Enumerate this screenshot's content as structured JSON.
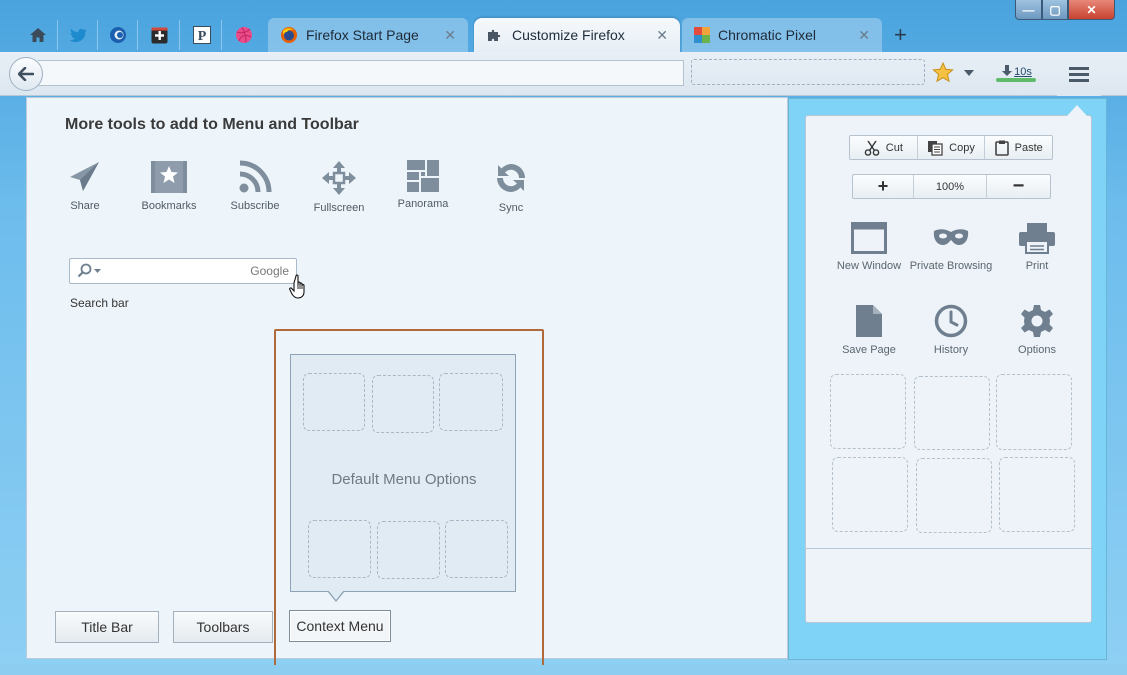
{
  "window": {
    "controls": {
      "minimize": "—",
      "maximize": "▢",
      "close": "✕"
    }
  },
  "tabs": {
    "pinned": [
      {
        "name": "home-icon"
      },
      {
        "name": "twitter-icon"
      },
      {
        "name": "thunderbird-icon"
      },
      {
        "name": "google-plus-icon"
      },
      {
        "name": "pinterest-icon"
      },
      {
        "name": "dribbble-icon"
      }
    ],
    "items": [
      {
        "label": "Firefox Start Page",
        "icon": "firefox-icon",
        "active": false
      },
      {
        "label": "Customize Firefox",
        "icon": "puzzle-icon",
        "active": true
      },
      {
        "label": "Chromatic Pixel",
        "icon": "chromatic-pixel-icon",
        "active": false
      }
    ],
    "close_glyph": "✕",
    "new_tab_glyph": "+"
  },
  "navbar": {
    "download_count": "10s",
    "bookmark_star_color": "#f2b632"
  },
  "customize": {
    "heading": "More tools to add to Menu and Toolbar",
    "tools": [
      {
        "label": "Share",
        "icon": "share-icon"
      },
      {
        "label": "Bookmarks",
        "icon": "bookmarks-icon"
      },
      {
        "label": "Subscribe",
        "icon": "rss-icon"
      },
      {
        "label": "Fullscreen",
        "icon": "fullscreen-icon"
      },
      {
        "label": "Panorama",
        "icon": "panorama-icon"
      },
      {
        "label": "Sync",
        "icon": "sync-icon"
      }
    ],
    "search_engine": "Google",
    "search_label": "Search bar",
    "context_menu_text": "Default Menu Options",
    "bottom_buttons": {
      "title_bar": "Title Bar",
      "toolbars": "Toolbars",
      "context_menu": "Context Menu"
    },
    "highlight_color": "#b0693a"
  },
  "panel": {
    "edit": {
      "cut": "Cut",
      "copy": "Copy",
      "paste": "Paste"
    },
    "zoom": {
      "minus": "−",
      "plus": "+",
      "level": "100%"
    },
    "items": [
      {
        "label": "New Window",
        "icon": "new-window-icon"
      },
      {
        "label": "Private Browsing",
        "icon": "private-browsing-mask-icon"
      },
      {
        "label": "Print",
        "icon": "printer-icon"
      },
      {
        "label": "Save Page",
        "icon": "save-page-icon"
      },
      {
        "label": "History",
        "icon": "history-clock-icon"
      },
      {
        "label": "Options",
        "icon": "gear-icon"
      }
    ],
    "background_color": "#7ed3f7"
  }
}
